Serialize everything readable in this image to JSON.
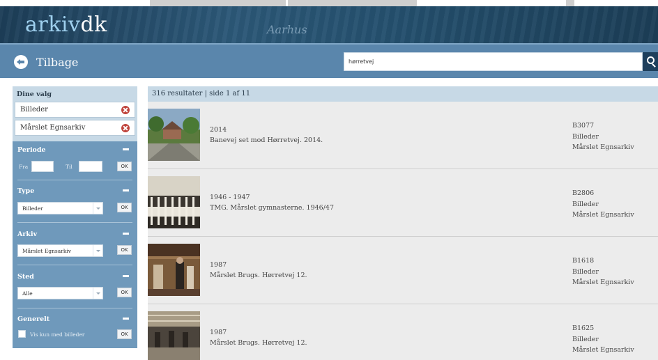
{
  "header": {
    "logo_part1": "arkiv",
    "logo_part2": "dk",
    "banner_script": "Aarhus"
  },
  "nav": {
    "back_label": "Tilbage",
    "search_value": "hørretvej"
  },
  "sidebar": {
    "choices_title": "Dine valg",
    "choices": [
      "Billeder",
      "Mårslet Egnsarkiv"
    ],
    "periode": {
      "title": "Periode",
      "from_label": "Fra",
      "to_label": "Til",
      "ok": "OK"
    },
    "type": {
      "title": "Type",
      "value": "Billeder",
      "ok": "OK"
    },
    "arkiv": {
      "title": "Arkiv",
      "value": "Mårslet Egnsarkiv",
      "ok": "OK"
    },
    "sted": {
      "title": "Sted",
      "value": "Alle",
      "ok": "OK"
    },
    "generelt": {
      "title": "Generelt",
      "checkbox_label": "Vis kun med billeder",
      "ok": "OK"
    }
  },
  "results": {
    "summary": "316 resultater | side 1 af 11",
    "items": [
      {
        "year": "2014",
        "description": "Banevej set mod Hørretvej. 2014.",
        "id": "B3077",
        "type": "Billeder",
        "archive": "Mårslet Egnsarkiv"
      },
      {
        "year": "1946 - 1947",
        "description": "TMG. Mårslet gymnasterne. 1946/47",
        "id": "B2806",
        "type": "Billeder",
        "archive": "Mårslet Egnsarkiv"
      },
      {
        "year": "1987",
        "description": "Mårslet Brugs. Hørretvej 12.",
        "id": "B1618",
        "type": "Billeder",
        "archive": "Mårslet Egnsarkiv"
      },
      {
        "year": "1987",
        "description": "Mårslet Brugs. Hørretvej 12.",
        "id": "B1625",
        "type": "Billeder",
        "archive": "Mårslet Egnsarkiv"
      }
    ]
  },
  "colors": {
    "banner": "#24506e",
    "navbar": "#5a86ac",
    "filter_panel": "#6f99bb",
    "light_panel": "#c7d9e6",
    "remove_icon": "#c0443c"
  }
}
